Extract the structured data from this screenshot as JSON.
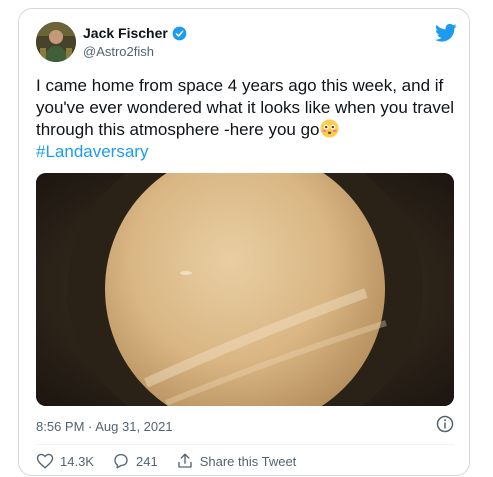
{
  "tweet": {
    "author_name": "Jack Fischer",
    "author_handle": "@Astro2fish",
    "text_main": "I came home from space 4 years ago this week, and if you've ever wondered what it looks like when you travel through this atmosphere -here you go",
    "hashtag": "#Landaversary",
    "timestamp": "8:56 PM · Aug 31, 2021",
    "likes": "14.3K",
    "replies": "241",
    "share_label": "Share this Tweet"
  },
  "icons": {
    "verified": "verified-badge-icon",
    "bird": "twitter-bird-icon",
    "emoji": "flushed-face-emoji",
    "info": "info-icon",
    "like": "heart-icon",
    "reply": "reply-bubble-icon",
    "share": "share-icon"
  },
  "colors": {
    "accent": "#1d9bf0",
    "text": "#0f1419",
    "muted": "#536471"
  }
}
